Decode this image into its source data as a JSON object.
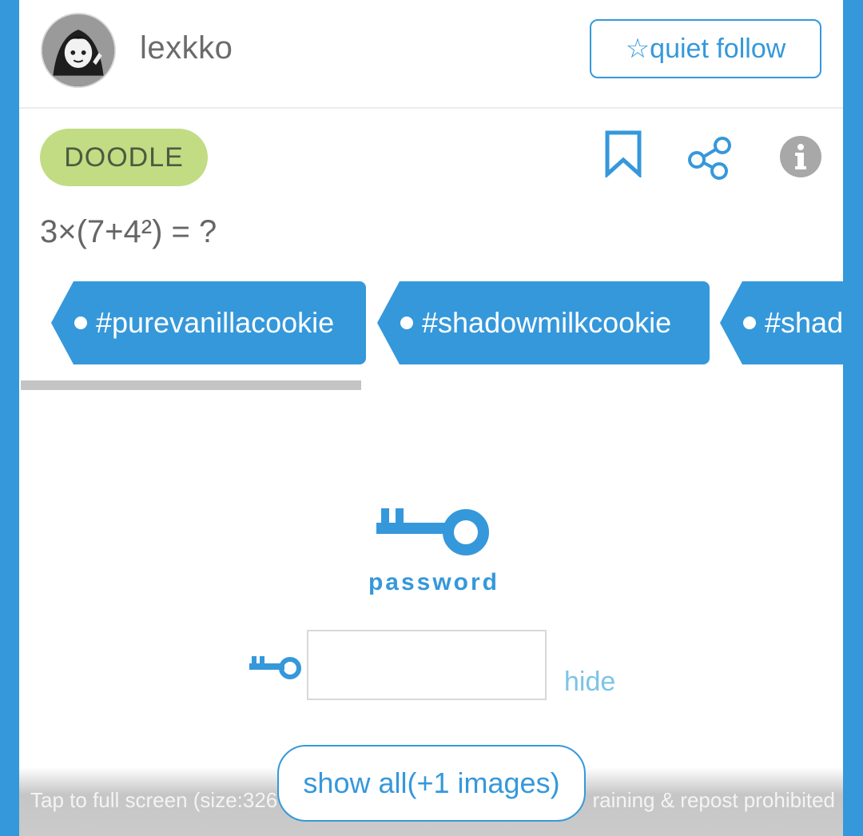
{
  "header": {
    "username": "lexkko",
    "follow_label": "☆quiet follow"
  },
  "post": {
    "category": "DOODLE",
    "title": "3×(7+4²) = ?",
    "tags": [
      "#purevanillacookie",
      "#shadowmilkcookie",
      "#shad"
    ]
  },
  "password": {
    "label": "password",
    "input_value": "",
    "hide_label": "hide"
  },
  "footer": {
    "overlay_left": "Tap to full screen (size:326",
    "overlay_right": "raining & repost prohibited",
    "show_all_label": "show all(+1 images)"
  },
  "colors": {
    "brand_blue": "#3598db",
    "tag_green": "#c2dc83",
    "hide_link": "#7cc4e6"
  }
}
